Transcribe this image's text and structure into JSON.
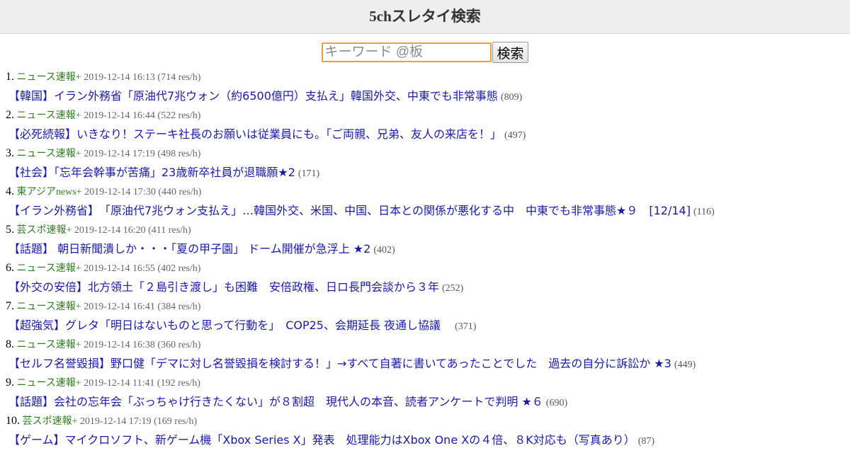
{
  "header": {
    "title": "5chスレタイ検索"
  },
  "search": {
    "placeholder": "キーワード @板",
    "value": "",
    "button_label": "検索"
  },
  "results": [
    {
      "rank": "1.",
      "board": "ニュース速報+",
      "datetime": "2019-12-14 16:13",
      "rate": "(714 res/h)",
      "title": "【韓国】イラン外務省「原油代7兆ウォン（約6500億円）支払え」韓国外交、中東でも非常事態",
      "count": "(809)"
    },
    {
      "rank": "2.",
      "board": "ニュース速報+",
      "datetime": "2019-12-14 16:44",
      "rate": "(522 res/h)",
      "title": "【必死続報】いきなり！ステーキ社長のお願いは従業員にも。「ご両親、兄弟、友人の来店を！」",
      "count": "(497)"
    },
    {
      "rank": "3.",
      "board": "ニュース速報+",
      "datetime": "2019-12-14 17:19",
      "rate": "(498 res/h)",
      "title": "【社会】「忘年会幹事が苦痛」23歳新卒社員が退職願★2",
      "count": "(171)"
    },
    {
      "rank": "4.",
      "board": "東アジアnews+",
      "datetime": "2019-12-14 17:30",
      "rate": "(440 res/h)",
      "title": "【イラン外務省】　「原油代7兆ウォン支払え」…韓国外交、米国、中国、日本との関係が悪化する中　中東でも非常事態★９　[12/14]",
      "count": "(116)"
    },
    {
      "rank": "5.",
      "board": "芸スポ速報+",
      "datetime": "2019-12-14 16:20",
      "rate": "(411 res/h)",
      "title": "【話題】 朝日新聞潰しか・・・「夏の甲子園」 ドーム開催が急浮上 ★2",
      "count": "(402)"
    },
    {
      "rank": "6.",
      "board": "ニュース速報+",
      "datetime": "2019-12-14 16:55",
      "rate": "(402 res/h)",
      "title": "【外交の安倍】北方領土「２島引き渡し」も困難　安倍政権、日ロ長門会談から３年",
      "count": "(252)"
    },
    {
      "rank": "7.",
      "board": "ニュース速報+",
      "datetime": "2019-12-14 16:41",
      "rate": "(384 res/h)",
      "title": "【超強気】グレタ「明日はないものと思って行動を」　COP25、会期延長 夜通し協議　",
      "count": "(371)"
    },
    {
      "rank": "8.",
      "board": "ニュース速報+",
      "datetime": "2019-12-14 16:38",
      "rate": "(360 res/h)",
      "title": "【セルフ名誉毀損】野口健「デマに対し名誉毀損を検討する！」→すべて自著に書いてあったことでした　過去の自分に訴訟か ★3",
      "count": "(449)"
    },
    {
      "rank": "9.",
      "board": "ニュース速報+",
      "datetime": "2019-12-14 11:41",
      "rate": "(192 res/h)",
      "title": "【話題】会社の忘年会「ぶっちゃけ行きたくない」が８割超　現代人の本音、読者アンケートで判明 ★６",
      "count": "(690)"
    },
    {
      "rank": "10.",
      "board": "芸スポ速報+",
      "datetime": "2019-12-14 17:19",
      "rate": "(169 res/h)",
      "title": "【ゲーム】マイクロソフト、新ゲーム機「Xbox Series X」発表　処理能力はXbox One Xの４倍、８K対応も（写真あり）",
      "count": "(87)"
    }
  ]
}
